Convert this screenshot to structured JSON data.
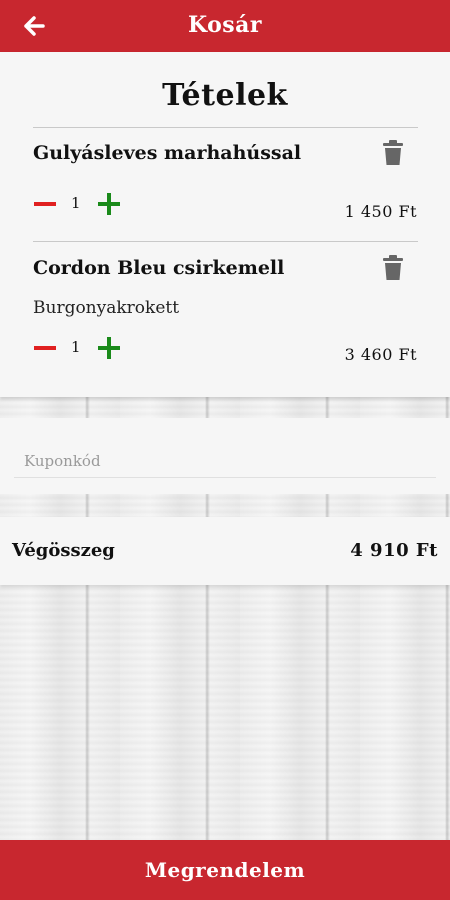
{
  "header": {
    "title": "Kosár"
  },
  "items_heading": "Tételek",
  "items": [
    {
      "name": "Gulyásleves marhahússal",
      "sub": "",
      "quantity": "1",
      "price": "1 450 Ft"
    },
    {
      "name": "Cordon Bleu csirkemell",
      "sub": "Burgonyakrokett",
      "quantity": "1",
      "price": "3 460 Ft"
    }
  ],
  "coupon": {
    "placeholder": "Kuponkód"
  },
  "total": {
    "label": "Végösszeg",
    "value": "4 910 Ft"
  },
  "order_button": "Megrendelem",
  "colors": {
    "brand": "#c8272f",
    "minus": "#e02020",
    "plus": "#1a8a1a",
    "trash": "#666666"
  }
}
